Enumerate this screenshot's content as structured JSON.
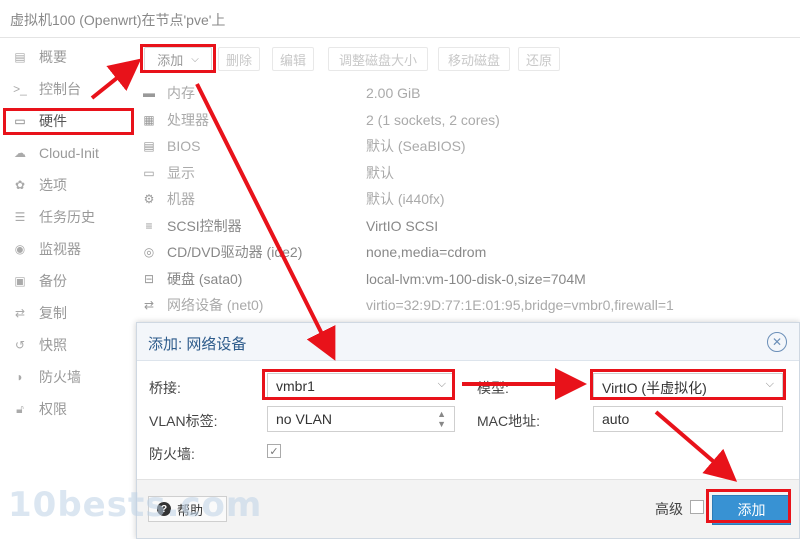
{
  "window": {
    "title": "虚拟机100 (Openwrt)在节点'pve'上"
  },
  "sidebar": {
    "items": [
      {
        "label": "概要",
        "icon": "book-icon",
        "glyph": "▤"
      },
      {
        "label": "控制台",
        "icon": "terminal-icon",
        "glyph": ">_"
      },
      {
        "label": "硬件",
        "icon": "monitor-icon",
        "glyph": "▭"
      },
      {
        "label": "Cloud-Init",
        "icon": "cloud-icon",
        "glyph": "☁"
      },
      {
        "label": "选项",
        "icon": "gear-icon",
        "glyph": "✿"
      },
      {
        "label": "任务历史",
        "icon": "list-icon",
        "glyph": "☰"
      },
      {
        "label": "监视器",
        "icon": "eye-icon",
        "glyph": "◉"
      },
      {
        "label": "备份",
        "icon": "floppy-icon",
        "glyph": "▣"
      },
      {
        "label": "复制",
        "icon": "retweet-icon",
        "glyph": "⇄"
      },
      {
        "label": "快照",
        "icon": "history-icon",
        "glyph": "↺"
      },
      {
        "label": "防火墙",
        "icon": "shield-icon",
        "glyph": "◗"
      },
      {
        "label": "权限",
        "icon": "unlock-icon",
        "glyph": "🔓︎"
      }
    ]
  },
  "toolbar": {
    "add": "添加",
    "remove": "删除",
    "edit": "编辑",
    "resize": "调整磁盘大小",
    "move": "移动磁盘",
    "revert": "还原"
  },
  "hardware": [
    {
      "name": "内存",
      "value": "2.00 GiB",
      "icon": "memory-icon",
      "glyph": "▬"
    },
    {
      "name": "处理器",
      "value": "2 (1 sockets, 2 cores)",
      "icon": "cpu-icon",
      "glyph": "▦"
    },
    {
      "name": "BIOS",
      "value": "默认 (SeaBIOS)",
      "icon": "microchip-icon",
      "glyph": "▤"
    },
    {
      "name": "显示",
      "value": "默认",
      "icon": "desktop-icon",
      "glyph": "▭"
    },
    {
      "name": "机器",
      "value": "默认 (i440fx)",
      "icon": "cogs-icon",
      "glyph": "⚙"
    },
    {
      "name": "SCSI控制器",
      "value": "VirtIO SCSI",
      "icon": "database-icon",
      "glyph": "≡"
    },
    {
      "name": "CD/DVD驱动器 (ide2)",
      "value": "none,media=cdrom",
      "icon": "cdrom-icon",
      "glyph": "◎"
    },
    {
      "name": "硬盘 (sata0)",
      "value": "local-lvm:vm-100-disk-0,size=704M",
      "icon": "hdd-icon",
      "glyph": "⊟"
    },
    {
      "name": "网络设备 (net0)",
      "value": "virtio=32:9D:77:1E:01:95,bridge=vmbr0,firewall=1",
      "icon": "exchange-icon",
      "glyph": "⇄"
    }
  ],
  "dialog": {
    "title": "添加: 网络设备",
    "bridge_label": "桥接:",
    "bridge_value": "vmbr1",
    "model_label": "模型:",
    "model_value": "VirtIO (半虚拟化)",
    "vlan_label": "VLAN标签:",
    "vlan_value": "no VLAN",
    "mac_label": "MAC地址:",
    "mac_value": "auto",
    "firewall_label": "防火墙:",
    "firewall_checked": true,
    "help_label": "帮助",
    "advanced_label": "高级",
    "advanced_checked": false,
    "add_label": "添加"
  },
  "watermark": "10bests.com",
  "colors": {
    "highlight": "#e8121a",
    "primary_button": "#3892d3",
    "dialog_title": "#2d5b8b"
  }
}
